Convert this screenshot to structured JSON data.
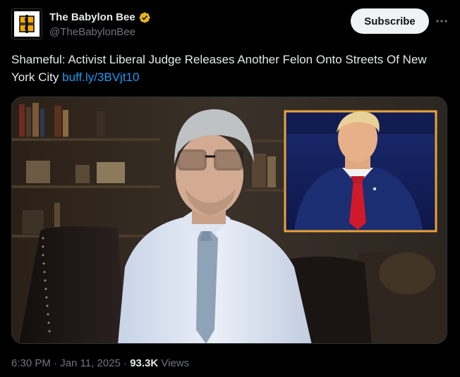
{
  "account": {
    "display_name": "The Babylon Bee",
    "handle": "@TheBabylonBee",
    "verified_badge": "gold-verified-badge",
    "logo_text": "BB"
  },
  "header": {
    "subscribe_label": "Subscribe",
    "more_icon": "more-horizontal-icon"
  },
  "tweet": {
    "text": "Shameful: Activist Liberal Judge Releases Another Felon Onto Streets Of New York City",
    "link_text": "buff.ly/3BVjt10"
  },
  "media": {
    "description_icon": "photo",
    "inset_frame_color": "#e8a33a"
  },
  "meta": {
    "time": "6:30 PM",
    "separator": "·",
    "date": "Jan 11, 2025",
    "views_count": "93.3K",
    "views_label": "Views"
  },
  "colors": {
    "background": "#000000",
    "text": "#e7e9ea",
    "secondary": "#71767b",
    "link": "#1d9bf0",
    "verified_gold": "#e2b719"
  }
}
